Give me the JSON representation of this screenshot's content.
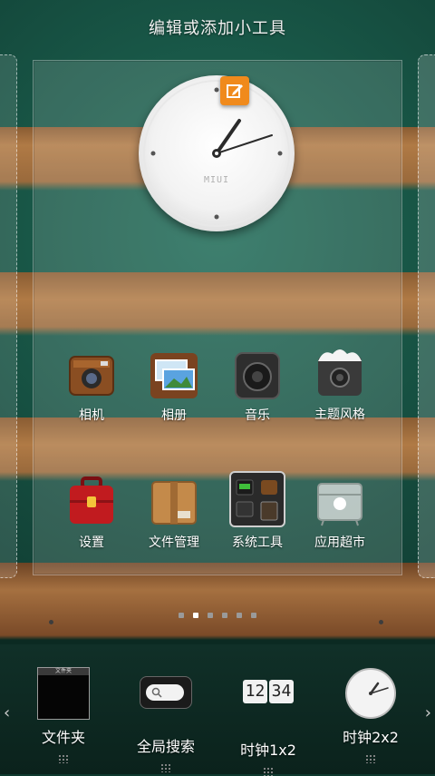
{
  "header": {
    "title": "编辑或添加小工具"
  },
  "clock_widget": {
    "brand": "MIUI"
  },
  "apps_row1": [
    {
      "label": "相机",
      "icon": "camera-icon"
    },
    {
      "label": "相册",
      "icon": "gallery-icon"
    },
    {
      "label": "音乐",
      "icon": "music-speaker-icon"
    },
    {
      "label": "主题风格",
      "icon": "theme-icon"
    }
  ],
  "apps_row2": [
    {
      "label": "设置",
      "icon": "settings-toolbox-icon"
    },
    {
      "label": "文件管理",
      "icon": "file-box-icon"
    },
    {
      "label": "系统工具",
      "icon": "system-tools-folder-icon"
    },
    {
      "label": "应用超市",
      "icon": "app-store-icon"
    }
  ],
  "pager": {
    "count": 6,
    "active_index": 1
  },
  "tray": {
    "widgets": [
      {
        "label": "文件夹",
        "icon": "folder-widget-icon",
        "preview_title": "文件夹"
      },
      {
        "label": "全局搜索",
        "icon": "search-widget-icon"
      },
      {
        "label": "时钟1x2",
        "icon": "digital-clock-icon",
        "time_h": "12",
        "time_m": "34"
      },
      {
        "label": "时钟2x2",
        "icon": "analog-clock-icon"
      }
    ],
    "prev_arrow": "‹",
    "next_arrow": "›"
  },
  "colors": {
    "accent_orange": "#f08a1c",
    "panel_green": "#14493c"
  }
}
